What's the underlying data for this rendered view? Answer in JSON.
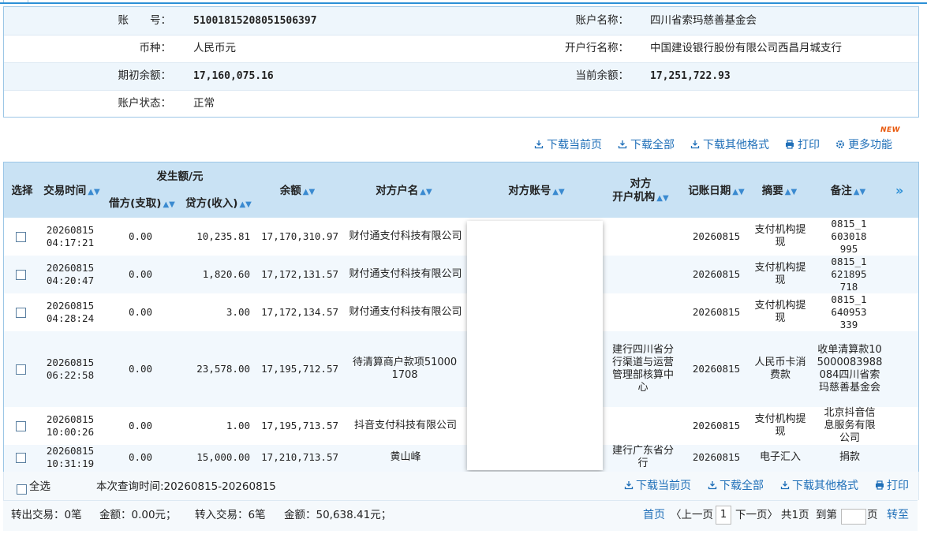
{
  "account": {
    "rows": [
      {
        "label": "账　　号：",
        "value": "51001815208051506397",
        "label2": "账户名称：",
        "value2": "四川省索玛慈善基金会"
      },
      {
        "label": "币种：",
        "value": "人民币元",
        "label2": "开户行名称：",
        "value2": "中国建设银行股份有限公司西昌月城支行"
      },
      {
        "label": "期初余额：",
        "value": "17,160,075.16",
        "label2": "当前余额：",
        "value2": "17,251,722.93"
      },
      {
        "label": "账户状态：",
        "value": "正常"
      }
    ]
  },
  "toolbar": {
    "download_page": "下载当前页",
    "download_all": "下载全部",
    "download_other": "下载其他格式",
    "print": "打印",
    "more": "更多功能",
    "new_badge": "NEW"
  },
  "table": {
    "headers": {
      "select": "选择",
      "time": "交易时间",
      "amount_group": "发生额/元",
      "debit": "借方(支取)",
      "credit": "贷方(收入)",
      "balance": "余额",
      "counterparty_name": "对方户名",
      "counterparty_account": "对方账号",
      "counterparty_bank_l1": "对方",
      "counterparty_bank_l2": "开户机构",
      "post_date": "记账日期",
      "summary": "摘要",
      "remark": "备注",
      "more": "»"
    },
    "rows": [
      {
        "date": "20260815",
        "time": "04:17:21",
        "debit": "0.00",
        "credit": "10,235.81",
        "balance": "17,170,310.97",
        "name": "财付通支付科技有限公司",
        "bank": "",
        "post": "20260815",
        "summary": "支付机构提现",
        "remark": "0815_1603018995"
      },
      {
        "date": "20260815",
        "time": "04:20:47",
        "debit": "0.00",
        "credit": "1,820.60",
        "balance": "17,172,131.57",
        "name": "财付通支付科技有限公司",
        "bank": "",
        "post": "20260815",
        "summary": "支付机构提现",
        "remark": "0815_1621895718"
      },
      {
        "date": "20260815",
        "time": "04:28:24",
        "debit": "0.00",
        "credit": "3.00",
        "balance": "17,172,134.57",
        "name": "财付通支付科技有限公司",
        "bank": "",
        "post": "20260815",
        "summary": "支付机构提现",
        "remark": "0815_1640953339"
      },
      {
        "date": "20260815",
        "time": "06:22:58",
        "debit": "0.00",
        "credit": "23,578.00",
        "balance": "17,195,712.57",
        "name": "待清算商户款项510001708",
        "bank": "建行四川省分行渠道与运营管理部核算中心",
        "post": "20260815",
        "summary": "人民币卡消费款",
        "remark": "收单清算款105000083988084四川省索玛慈善基金会"
      },
      {
        "date": "20260815",
        "time": "10:00:26",
        "debit": "0.00",
        "credit": "1.00",
        "balance": "17,195,713.57",
        "name": "抖音支付科技有限公司",
        "bank": "",
        "post": "20260815",
        "summary": "支付机构提现",
        "remark": "北京抖音信息服务有限公司"
      },
      {
        "date": "20260815",
        "time": "10:31:19",
        "debit": "0.00",
        "credit": "15,000.00",
        "balance": "17,210,713.57",
        "name": "黄山峰",
        "bank": "建行广东省分行",
        "post": "20260815",
        "summary": "电子汇入",
        "remark": "捐款"
      }
    ]
  },
  "footer": {
    "select_all": "全选",
    "query_time": "本次查询时间:20260815-20260815",
    "download_page": "下载当前页",
    "download_all": "下载全部",
    "download_other": "下载其他格式",
    "print": "打印",
    "out_count": "转出交易：0笔",
    "out_amount": "金额：0.00元；",
    "in_count": "转入交易：6笔",
    "in_amount": "金额：50,638.41元；",
    "first": "首页",
    "prev": "〈上一页",
    "current_page": "1",
    "next": "下一页〉",
    "total": "共1页",
    "goto": "到第",
    "page_unit": "页",
    "go": "转至"
  },
  "colors": {
    "accent": "#2b8fd6",
    "link": "#1f6fb8",
    "header_bg": "#c9e2f4",
    "row_alt": "#f2f8fd",
    "new_badge": "#e8580c"
  }
}
